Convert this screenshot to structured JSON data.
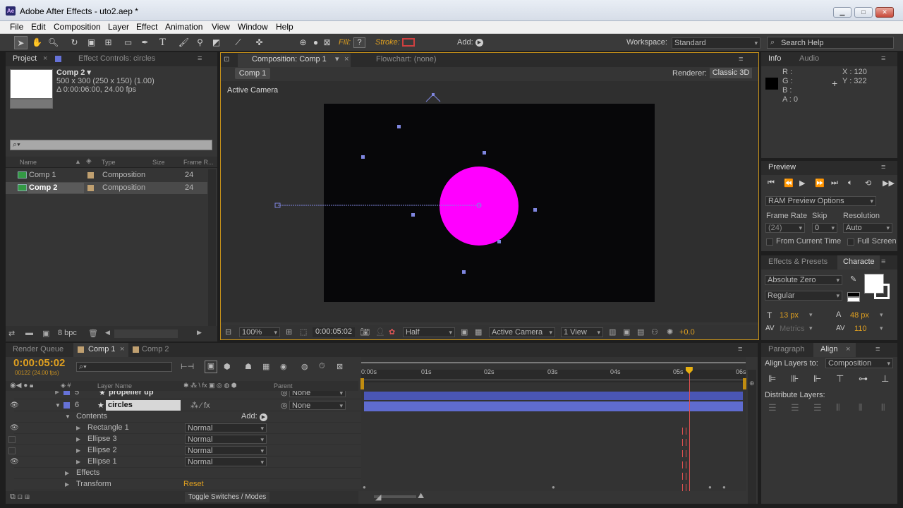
{
  "window": {
    "title": "Adobe After Effects - uto2.aep *",
    "app_icon": "Ae",
    "controls": [
      "minimize",
      "maximize",
      "close"
    ]
  },
  "menu": [
    "File",
    "Edit",
    "Composition",
    "Layer",
    "Effect",
    "Animation",
    "View",
    "Window",
    "Help"
  ],
  "toolbar": {
    "fill_label": "Fill:",
    "fill_value": "?",
    "stroke_label": "Stroke:",
    "add_label": "Add:",
    "workspace_label": "Workspace:",
    "workspace_value": "Standard",
    "search_placeholder": "Search Help"
  },
  "project_panel": {
    "tabs": [
      "Project",
      "Effect Controls: circles"
    ],
    "comp_name": "Comp 2 ▾",
    "comp_info_1": "500 x 300  (250 x 150) (1.00)",
    "comp_info_2": "Δ 0:00:06:00, 24.00 fps",
    "search_placeholder": "⌕▾",
    "columns": [
      "Name",
      "Type",
      "Size",
      "Frame R..."
    ],
    "items": [
      {
        "name": "Comp 1",
        "type": "Composition",
        "frame_rate": "24"
      },
      {
        "name": "Comp 2",
        "type": "Composition",
        "frame_rate": "24"
      }
    ],
    "bpc": "8 bpc"
  },
  "comp_panel": {
    "tabs": [
      "Composition: Comp 1",
      "Flowchart: (none)"
    ],
    "breadcrumb": "Comp 1",
    "renderer_label": "Renderer:",
    "renderer_value": "Classic 3D",
    "camera_label": "Active Camera",
    "zoom": "100%",
    "timecode": "0:00:05:02",
    "resolution": "Half",
    "camera": "Active Camera",
    "views": "1 View",
    "exposure": "+0.0",
    "circle_color": "#ff00ff"
  },
  "info_panel": {
    "tabs": [
      "Info",
      "Audio"
    ],
    "r": "R :",
    "g": "G :",
    "b": "B :",
    "a": "A : 0",
    "x": "X : 120",
    "y": "Y : 322"
  },
  "preview_panel": {
    "title": "Preview",
    "ram_preview": "RAM Preview Options",
    "frame_rate_label": "Frame Rate",
    "skip_label": "Skip",
    "resolution_label": "Resolution",
    "frame_rate": "(24)",
    "skip": "0",
    "resolution": "Auto",
    "from_current": "From Current Time",
    "full_screen": "Full Screen"
  },
  "character_panel": {
    "tabs": [
      "Effects & Presets",
      "Characte"
    ],
    "font": "Absolute Zero",
    "style": "Regular",
    "size": "13 px",
    "leading": "48 px",
    "kerning": "Metrics",
    "tracking": "110"
  },
  "align_panel": {
    "tabs": [
      "Paragraph",
      "Align"
    ],
    "align_to_label": "Align Layers to:",
    "align_to_value": "Composition",
    "distribute_label": "Distribute Layers:"
  },
  "timeline": {
    "tabs": [
      "Render Queue",
      "Comp 1",
      "Comp 2"
    ],
    "timecode": "0:00:05:02",
    "fps": "00122 (24.00 fps)",
    "col_layer": "Layer Name",
    "col_parent": "Parent",
    "ruler": [
      "0:00s",
      "01s",
      "02s",
      "03s",
      "04s",
      "05s",
      "06s"
    ],
    "layers": [
      {
        "num": "5",
        "name": "propeller up",
        "parent": "None"
      },
      {
        "num": "6",
        "name": "circles",
        "parent": "None"
      }
    ],
    "contents_label": "Contents",
    "add_label": "Add:",
    "shapes": [
      {
        "name": "Rectangle 1",
        "mode": "Normal"
      },
      {
        "name": "Ellipse 3",
        "mode": "Normal"
      },
      {
        "name": "Ellipse 2",
        "mode": "Normal"
      },
      {
        "name": "Ellipse 1",
        "mode": "Normal"
      }
    ],
    "effects_label": "Effects",
    "transform_label": "Transform",
    "reset_label": "Reset",
    "toggle_label": "Toggle Switches / Modes",
    "playhead_fraction": 0.853
  }
}
